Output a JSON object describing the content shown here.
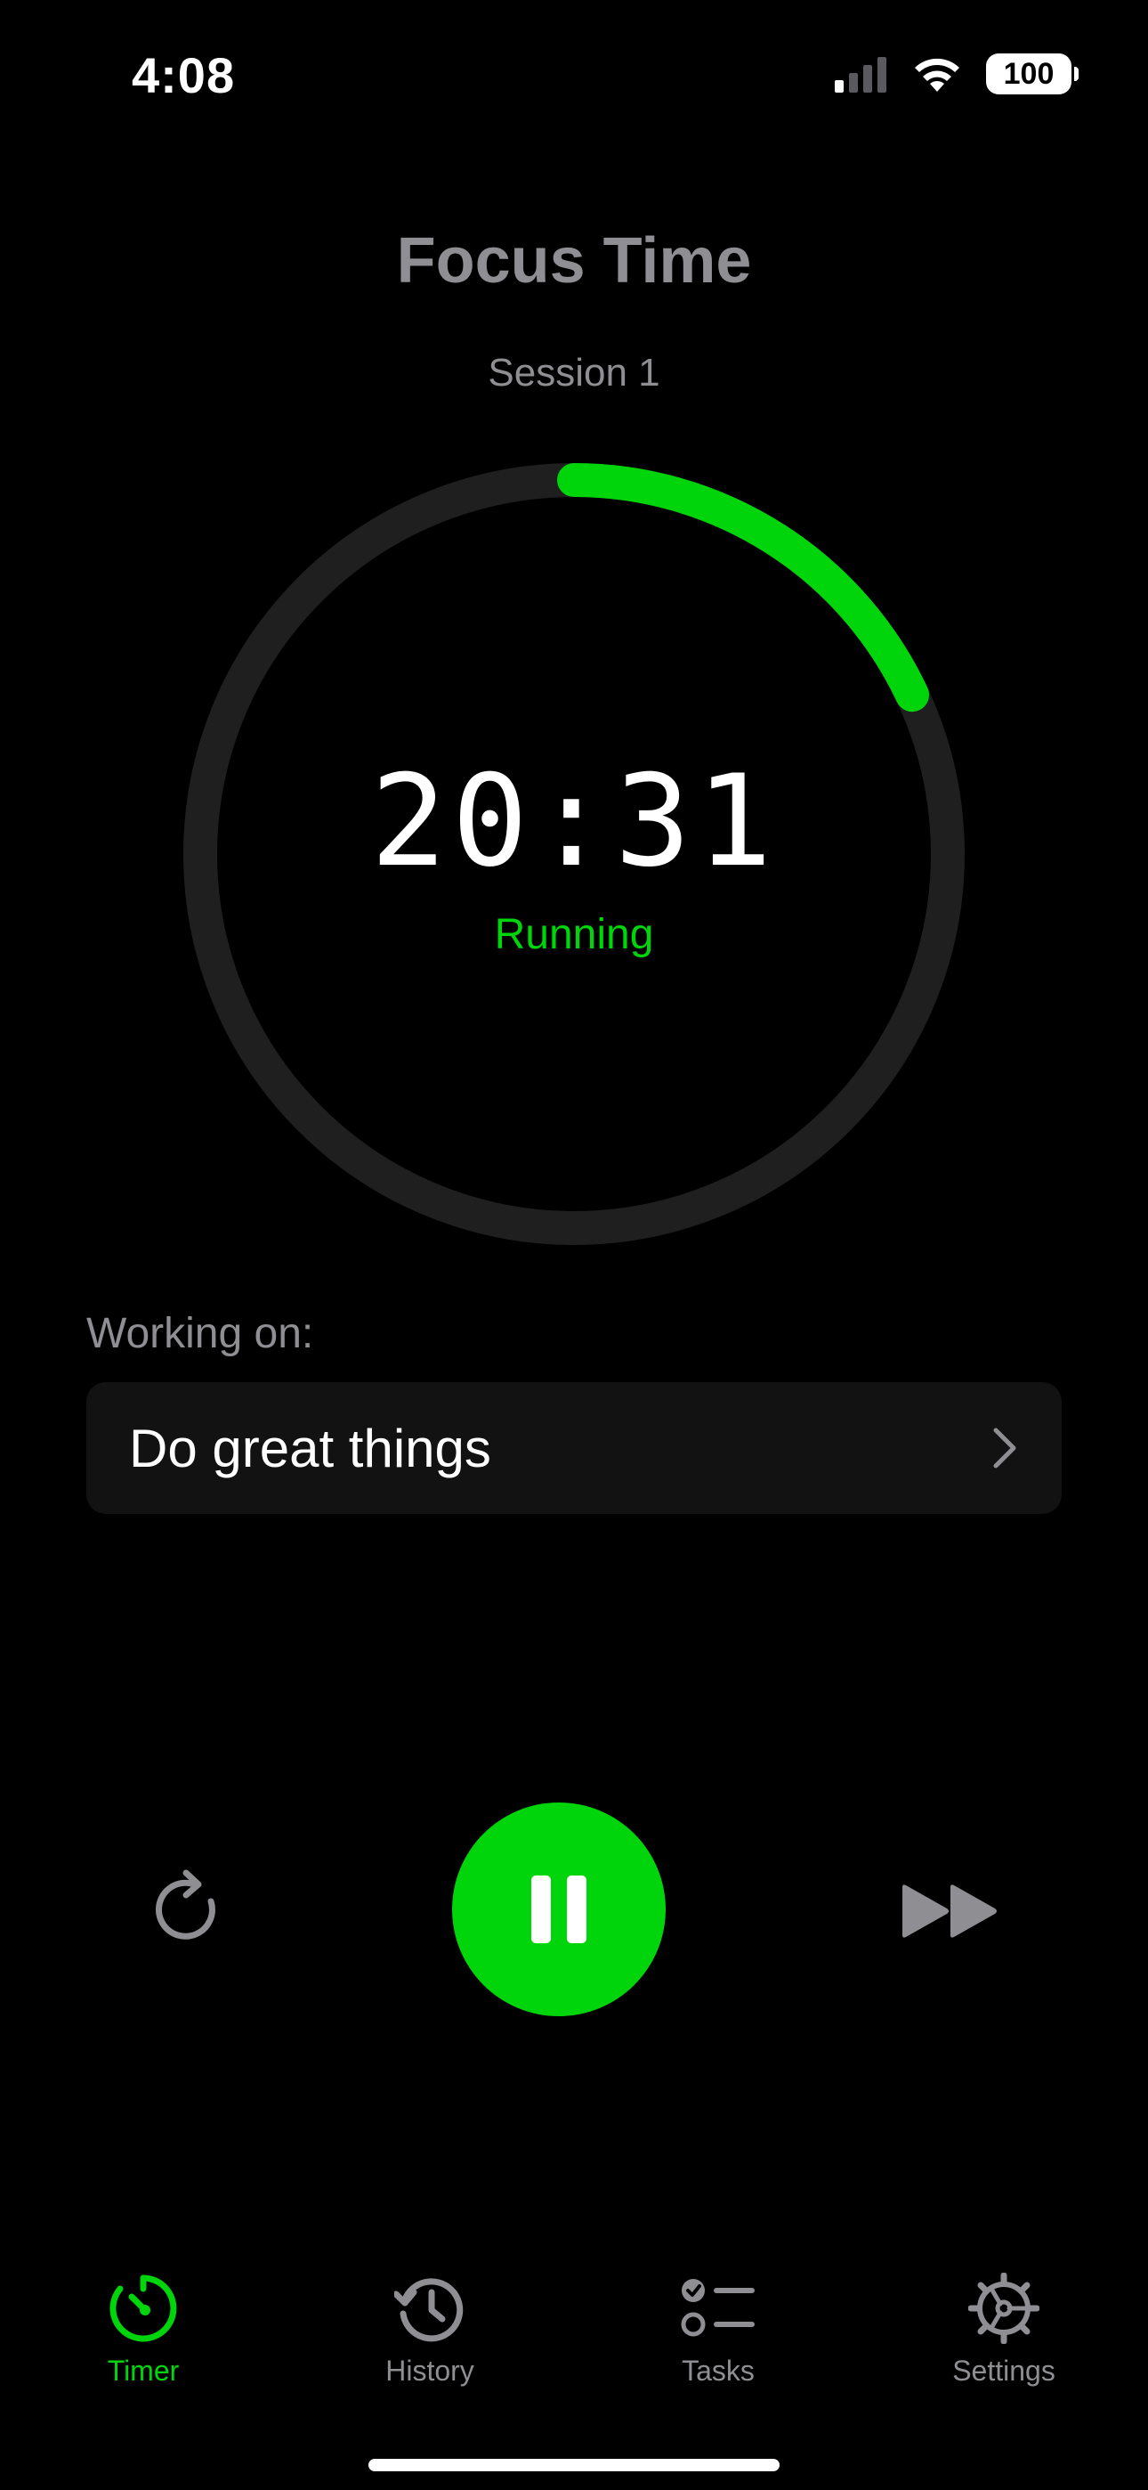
{
  "status_bar": {
    "time": "4:08",
    "battery": "100"
  },
  "header": {
    "title": "Focus Time",
    "subtitle": "Session 1"
  },
  "timer": {
    "display": "20:31",
    "state": "Running",
    "progress": 0.18
  },
  "working_on": {
    "label": "Working on:",
    "task": "Do great things"
  },
  "controls": {
    "reset_icon": "reset-icon",
    "pause_icon": "pause-icon",
    "skip_icon": "skip-forward-icon"
  },
  "tabs": [
    {
      "label": "Timer",
      "icon": "timer-icon",
      "active": true
    },
    {
      "label": "History",
      "icon": "history-icon",
      "active": false
    },
    {
      "label": "Tasks",
      "icon": "tasks-icon",
      "active": false
    },
    {
      "label": "Settings",
      "icon": "settings-icon",
      "active": false
    }
  ],
  "colors": {
    "accent": "#00d40b",
    "muted": "#8e8e93",
    "background": "#000000",
    "card": "#121212",
    "track": "#1f1f1f"
  }
}
